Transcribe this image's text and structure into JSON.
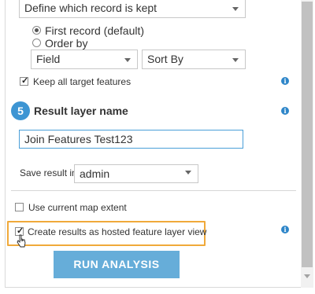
{
  "keep_record": {
    "select_value": "Define which record is kept",
    "options": [
      {
        "label": "First record (default)",
        "selected": true
      },
      {
        "label": "Order by",
        "selected": false
      }
    ],
    "field_select": "Field",
    "sort_select": "Sort By"
  },
  "keep_all": {
    "label": "Keep all target features",
    "checked": true
  },
  "step5": {
    "number": "5",
    "title": "Result layer name",
    "layer_name": "Join Features Test123",
    "save_label": "Save result in",
    "save_folder": "admin"
  },
  "use_extent": {
    "label": "Use current map extent",
    "checked": false
  },
  "hosted_view": {
    "label": "Create results as hosted feature layer view",
    "checked": true
  },
  "run_button": "RUN ANALYSIS",
  "colors": {
    "accent": "#3d95d3",
    "button": "#66add9",
    "highlight": "#f0a93a",
    "info_icon": "#2e86c9"
  }
}
